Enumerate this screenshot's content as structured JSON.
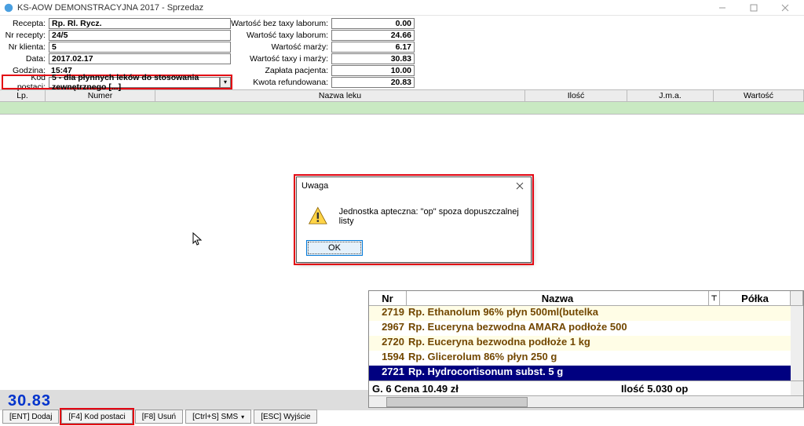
{
  "window": {
    "title": "KS-AOW DEMONSTRACYJNA 2017 - Sprzedaz"
  },
  "form": {
    "recepta_label": "Recepta:",
    "recepta": "Rp. Rl. Rycz.",
    "nrrecepty_label": "Nr recepty:",
    "nrrecepty": "24/5",
    "nrklienta_label": "Nr klienta:",
    "nrklienta": "5",
    "data_label": "Data:",
    "data": "2017.02.17",
    "godzina_label": "Godzina:",
    "godzina": "15:47",
    "kodpostaci_label": "Kod postaci:",
    "kodpostaci": "5 - dla płynnych leków do stosowania zewnętrznego [...]",
    "wart_bez_label": "Wartość bez taxy laborum:",
    "wart_bez": "0.00",
    "wart_taxy_label": "Wartość taxy laborum:",
    "wart_taxy": "24.66",
    "wart_marzy_label": "Wartość marży:",
    "wart_marzy": "6.17",
    "wart_taxy_marzy_label": "Wartość taxy i marży:",
    "wart_taxy_marzy": "30.83",
    "zaplata_label": "Zapłata pacjenta:",
    "zaplata": "10.00",
    "kwota_ref_label": "Kwota refundowana:",
    "kwota_ref": "20.83"
  },
  "tblhead": {
    "lp": "Lp.",
    "numer": "Numer",
    "nazwa": "Nazwa leku",
    "ilosc": "Ilość",
    "jma": "J.m.a.",
    "wartosc": "Wartość"
  },
  "modal": {
    "title": "Uwaga",
    "message": "Jednostka apteczna: \"op\" spoza dopuszczalnej listy",
    "ok": "OK"
  },
  "results": {
    "head": {
      "nr": "Nr",
      "nazwa": "Nazwa",
      "polka": "Półka"
    },
    "rows": [
      {
        "nr": "2719",
        "nazwa": "Rp. Ethanolum 96% płyn 500ml(butelka",
        "polka": ""
      },
      {
        "nr": "2967",
        "nazwa": "Rp. Euceryna bezwodna AMARA podłoże 500",
        "polka": ""
      },
      {
        "nr": "2720",
        "nazwa": "Rp. Euceryna bezwodna podłoże 1 kg",
        "polka": ""
      },
      {
        "nr": "1594",
        "nazwa": "Rp. Glicerolum 86% płyn 250 g",
        "polka": ""
      },
      {
        "nr": "2721",
        "nazwa": "Rp. Hydrocortisonum subst. 5 g",
        "polka": ""
      }
    ],
    "foot_left": "G. 6  Cena 10.49 zł",
    "foot_right": "Ilość 5.030 op"
  },
  "total": "30.83",
  "buttons": {
    "dodaj": "[ENT] Dodaj",
    "kod": "[F4] Kod postaci",
    "usun": "[F8] Usuń",
    "sms": "[Ctrl+S] SMS",
    "wyjscie": "[ESC] Wyjście"
  }
}
